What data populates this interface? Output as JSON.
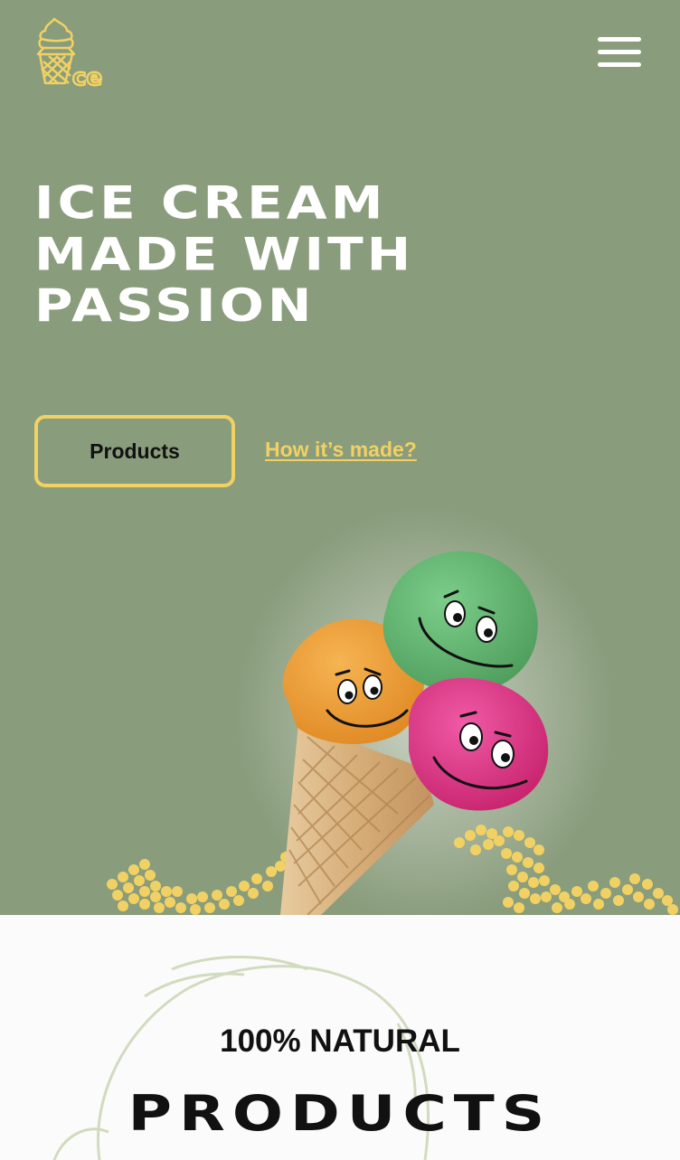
{
  "header": {
    "logo_text": "ce",
    "logo_icon": "ice-cream-cone-icon",
    "menu_icon": "hamburger-menu-icon"
  },
  "hero": {
    "title_lines": [
      "ICE CREAM",
      "MADE WITH",
      "PASSION"
    ],
    "primary_button": "Products",
    "secondary_link": "How it’s made?",
    "image_icon": "smiling-ice-cream-cone-illustration"
  },
  "section": {
    "kicker": "100% NATURAL",
    "heading": "PRODUCTS"
  },
  "colors": {
    "hero_bg": "#899c7c",
    "accent": "#f1d164",
    "text_dark": "#111111",
    "page_bg": "#fbfbfb"
  }
}
